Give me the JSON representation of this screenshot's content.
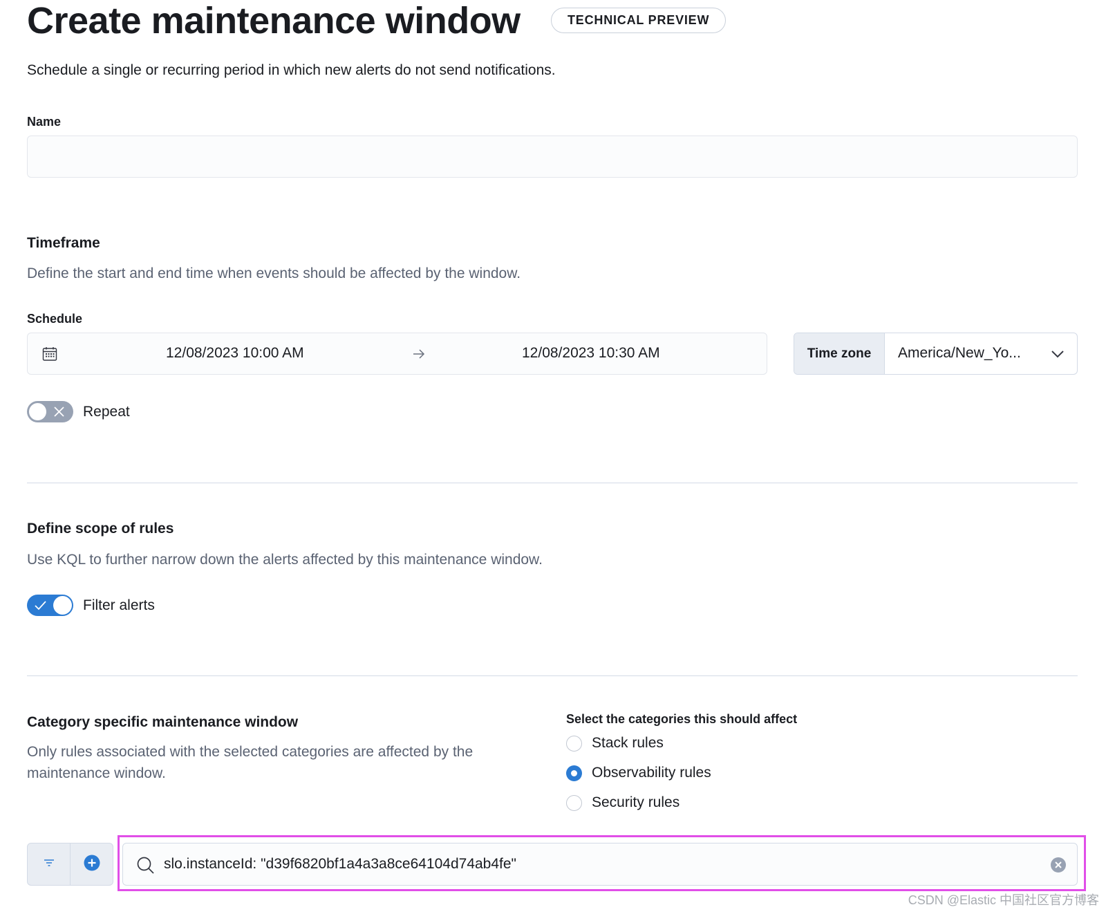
{
  "header": {
    "title": "Create maintenance window",
    "badge": "TECHNICAL PREVIEW",
    "description": "Schedule a single or recurring period in which new alerts do not send notifications."
  },
  "name_field": {
    "label": "Name",
    "value": "",
    "placeholder": ""
  },
  "timeframe": {
    "title": "Timeframe",
    "description": "Define the start and end time when events should be affected by the window.",
    "schedule_label": "Schedule",
    "start": "12/08/2023 10:00 AM",
    "end": "12/08/2023 10:30 AM",
    "timezone_label": "Time zone",
    "timezone_value": "America/New_Yo...",
    "repeat_label": "Repeat",
    "repeat_enabled": false
  },
  "scope": {
    "title": "Define scope of rules",
    "description": "Use KQL to further narrow down the alerts affected by this maintenance window.",
    "filter_label": "Filter alerts",
    "filter_enabled": true
  },
  "category": {
    "title": "Category specific maintenance window",
    "description": "Only rules associated with the selected categories are affected by the maintenance window.",
    "options_label": "Select the categories this should affect",
    "options": [
      {
        "label": "Stack rules",
        "selected": false
      },
      {
        "label": "Observability rules",
        "selected": true
      },
      {
        "label": "Security rules",
        "selected": false
      }
    ]
  },
  "kql": {
    "query": "slo.instanceId: \"d39f6820bf1a4a3a8ce64104d74ab4fe\""
  },
  "colors": {
    "primary": "#2b7bd3",
    "highlight": "#e14ee8",
    "toggle_off": "#98a2b3"
  },
  "watermark": "CSDN @Elastic 中国社区官方博客"
}
